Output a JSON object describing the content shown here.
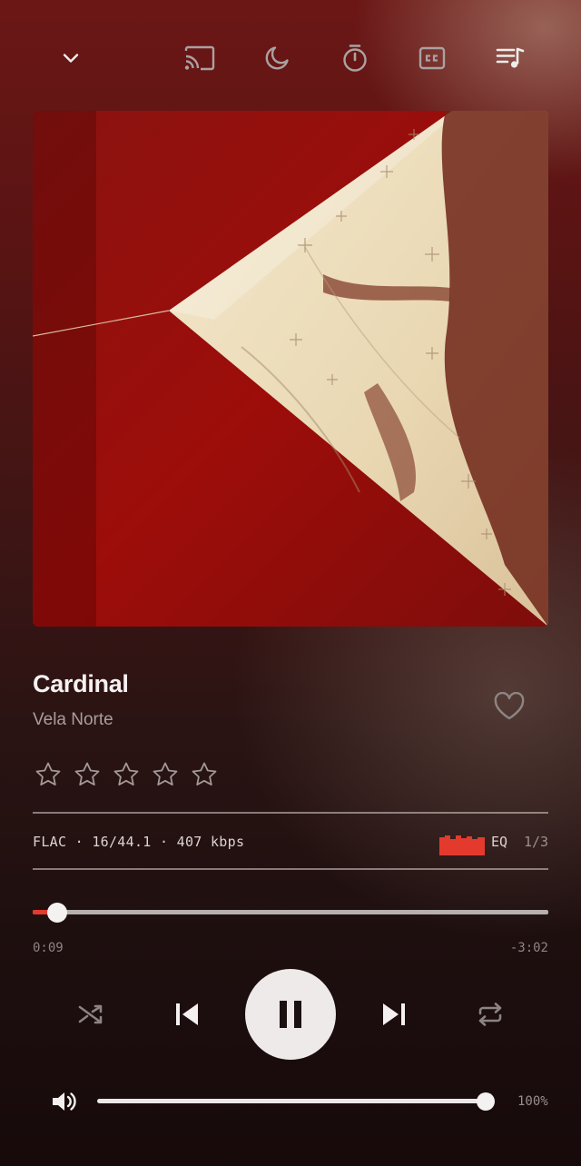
{
  "toolbar": {
    "icons": [
      "chevron-down-icon",
      "cast-icon",
      "sleep-moon-icon",
      "timer-icon",
      "closed-captions-icon",
      "queue-icon"
    ]
  },
  "album_art": {
    "image": "red backdrop with cream star-patterned sail and shadow",
    "colors": {
      "background": "#9a0f0c",
      "sail": "#f0e2c2",
      "shadow": "#6a2a1a"
    }
  },
  "track": {
    "title": "Cardinal",
    "artist": "Vela Norte",
    "favorite": false,
    "rating": 0,
    "rating_max": 5
  },
  "format": {
    "info": "FLAC · 16/44.1 · 407 kbps",
    "eq_label": "EQ",
    "page_indicator": "1/3"
  },
  "progress": {
    "elapsed": "0:09",
    "remaining": "-3:02",
    "fraction": 0.047
  },
  "controls": {
    "shuffle": "shuffle-icon",
    "previous": "skip-previous-icon",
    "play_pause": "pause-icon",
    "next": "skip-next-icon",
    "repeat": "repeat-icon"
  },
  "volume": {
    "level": 1.0,
    "label": "100%"
  },
  "colors": {
    "accent": "#e43a2e",
    "text_primary": "#f5f1f1",
    "text_secondary": "#a99d9d"
  }
}
